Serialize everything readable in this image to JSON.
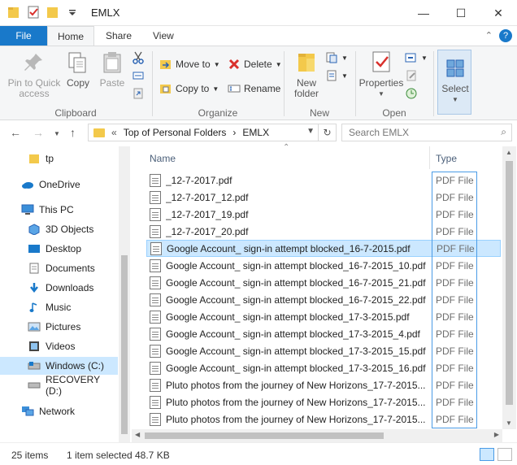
{
  "window": {
    "title": "EMLX",
    "minimize": "—",
    "maximize": "☐",
    "close": "✕"
  },
  "ribbon_tabs": {
    "file": "File",
    "home": "Home",
    "share": "Share",
    "view": "View"
  },
  "clipboard": {
    "pin": "Pin to Quick access",
    "copy": "Copy",
    "paste": "Paste",
    "label": "Clipboard"
  },
  "organize": {
    "move_to": "Move to",
    "copy_to": "Copy to",
    "delete": "Delete",
    "rename": "Rename",
    "label": "Organize"
  },
  "new_group": {
    "new_folder": "New folder",
    "label": "New"
  },
  "open_group": {
    "properties": "Properties",
    "label": "Open"
  },
  "select_group": {
    "select": "Select"
  },
  "address": {
    "chevrons": "«",
    "crumb1": "Top of Personal Folders",
    "arrow": "›",
    "crumb2": "EMLX",
    "search_placeholder": "Search EMLX"
  },
  "nav": {
    "items": [
      {
        "label": "tp",
        "icon": "folder-icon"
      },
      {
        "label": "OneDrive",
        "icon": "onedrive-icon"
      },
      {
        "label": "This PC",
        "icon": "computer-icon"
      },
      {
        "label": "3D Objects",
        "icon": "3d-objects-icon"
      },
      {
        "label": "Desktop",
        "icon": "desktop-icon"
      },
      {
        "label": "Documents",
        "icon": "documents-icon"
      },
      {
        "label": "Downloads",
        "icon": "downloads-icon"
      },
      {
        "label": "Music",
        "icon": "music-icon"
      },
      {
        "label": "Pictures",
        "icon": "pictures-icon"
      },
      {
        "label": "Videos",
        "icon": "videos-icon"
      },
      {
        "label": "Windows (C:)",
        "icon": "drive-icon"
      },
      {
        "label": "RECOVERY (D:)",
        "icon": "drive-icon"
      },
      {
        "label": "Network",
        "icon": "network-icon"
      }
    ]
  },
  "columns": {
    "name": "Name",
    "type": "Type"
  },
  "files": [
    {
      "name": "_12-7-2017.pdf",
      "type": "PDF File"
    },
    {
      "name": "_12-7-2017_12.pdf",
      "type": "PDF File"
    },
    {
      "name": "_12-7-2017_19.pdf",
      "type": "PDF File"
    },
    {
      "name": "_12-7-2017_20.pdf",
      "type": "PDF File"
    },
    {
      "name": "Google Account_ sign-in attempt blocked_16-7-2015.pdf",
      "type": "PDF File"
    },
    {
      "name": "Google Account_ sign-in attempt blocked_16-7-2015_10.pdf",
      "type": "PDF File"
    },
    {
      "name": "Google Account_ sign-in attempt blocked_16-7-2015_21.pdf",
      "type": "PDF File"
    },
    {
      "name": "Google Account_ sign-in attempt blocked_16-7-2015_22.pdf",
      "type": "PDF File"
    },
    {
      "name": "Google Account_ sign-in attempt blocked_17-3-2015.pdf",
      "type": "PDF File"
    },
    {
      "name": "Google Account_ sign-in attempt blocked_17-3-2015_4.pdf",
      "type": "PDF File"
    },
    {
      "name": "Google Account_ sign-in attempt blocked_17-3-2015_15.pdf",
      "type": "PDF File"
    },
    {
      "name": "Google Account_ sign-in attempt blocked_17-3-2015_16.pdf",
      "type": "PDF File"
    },
    {
      "name": "Pluto photos from the journey of New Horizons_17-7-2015...",
      "type": "PDF File"
    },
    {
      "name": "Pluto photos from the journey of New Horizons_17-7-2015...",
      "type": "PDF File"
    },
    {
      "name": "Pluto photos from the journey of New Horizons_17-7-2015...",
      "type": "PDF File"
    }
  ],
  "selected_index": 4,
  "status": {
    "count": "25 items",
    "selection": "1 item selected",
    "size": "48.7 KB"
  },
  "colors": {
    "accent": "#1979ca",
    "selection": "#cce8ff",
    "selection_border": "#99d1ff"
  }
}
